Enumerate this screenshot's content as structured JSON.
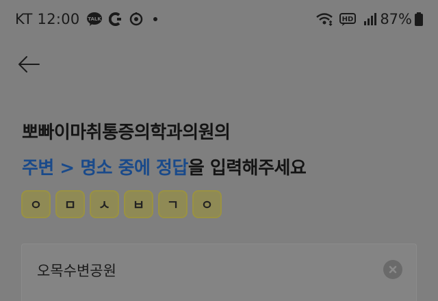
{
  "status_bar": {
    "carrier_time": "KT 12:00",
    "talk_badge": "TALK",
    "hd_badge": "HD",
    "battery": "87%",
    "icons": [
      "kakaotalk-icon",
      "app-c-icon",
      "target-icon",
      "dot-icon",
      "wifi-icon",
      "hd-voice-icon",
      "signal-icon",
      "battery-icon"
    ]
  },
  "header": {
    "back_icon": "arrow-left-icon"
  },
  "question": {
    "line1": "뽀빠이마취통증의학과의원의",
    "accent": "주변 > 명소 중에 정답",
    "line2_rest": "을 입력해주세요"
  },
  "hint_tiles": [
    "ㅇ",
    "ㅁ",
    "ㅅ",
    "ㅂ",
    "ㄱ",
    "ㅇ"
  ],
  "answer": {
    "value": "오목수변공원",
    "clear_icon": "clear-x-icon"
  },
  "colors": {
    "overlay_bg": "#7f7f7f",
    "accent_text": "#1a4a8a",
    "tile_bg": "#8f8a55",
    "tile_border": "#9a9242"
  }
}
